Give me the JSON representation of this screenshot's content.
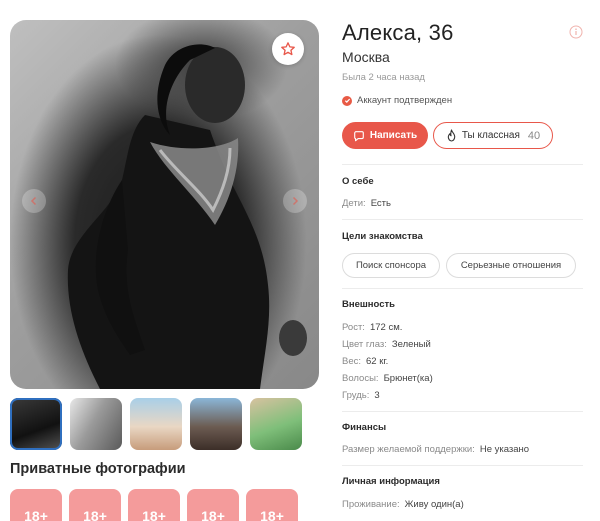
{
  "profile": {
    "name": "Алекса, 36",
    "city": "Москва",
    "last_seen": "Была 2 часа назад",
    "verified": "Аккаунт подтвержден"
  },
  "actions": {
    "write_label": "Написать",
    "like_label": "Ты классная",
    "like_count": "40"
  },
  "about": {
    "title": "О себе",
    "children_key": "Дети:",
    "children_value": "Есть"
  },
  "goals": {
    "title": "Цели знакомства",
    "chips": [
      "Поиск спонсора",
      "Серьезные отношения"
    ]
  },
  "appearance": {
    "title": "Внешность",
    "rows": [
      {
        "key": "Рост:",
        "value": "172 см."
      },
      {
        "key": "Цвет глаз:",
        "value": "Зеленый"
      },
      {
        "key": "Вес:",
        "value": "62 кг."
      },
      {
        "key": "Волосы:",
        "value": "Брюнет(ка)"
      },
      {
        "key": "Грудь:",
        "value": "3"
      }
    ]
  },
  "finance": {
    "title": "Финансы",
    "support_key": "Размер желаемой поддержки:",
    "support_value": "Не указано"
  },
  "personal": {
    "title": "Личная информация",
    "living_key": "Проживание:",
    "living_value": "Живу один(а)"
  },
  "gallery": {
    "private_title": "Приватные фотографии",
    "private_badges": [
      "18+",
      "18+",
      "18+",
      "18+",
      "18+"
    ]
  },
  "colors": {
    "accent": "#e8574a",
    "private_card": "#f49b9b"
  },
  "icons": {
    "favorite": "star-icon",
    "info": "info-icon",
    "verified": "check-icon",
    "write": "chat-icon",
    "like": "flame-icon"
  }
}
